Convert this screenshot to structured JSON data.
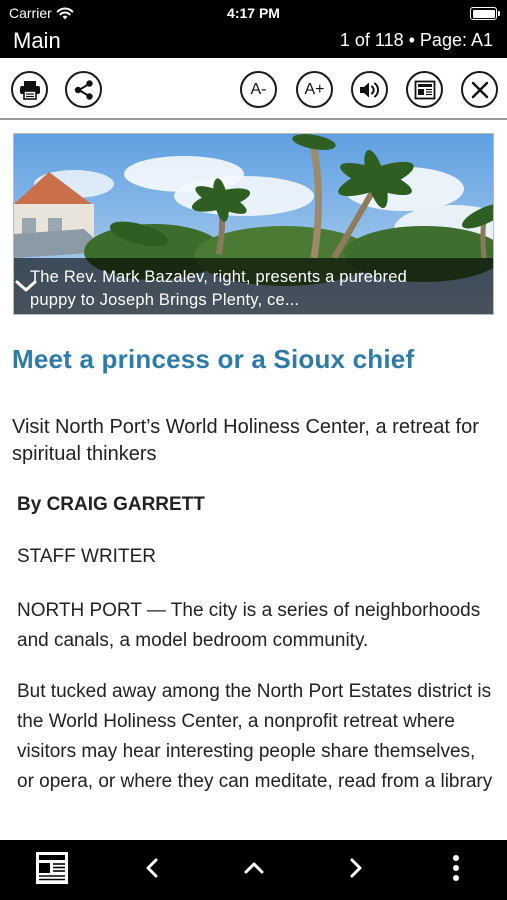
{
  "status_bar": {
    "carrier": "Carrier",
    "time": "4:17 PM",
    "battery_level": 1.0
  },
  "nav": {
    "section": "Main",
    "page_info": "1 of 118 • Page: A1"
  },
  "toolbar": {
    "decrease_font_label": "A-",
    "increase_font_label": "A+",
    "icons": [
      "printer-icon",
      "share-icon",
      "speaker-icon",
      "newspaper-icon",
      "close-icon"
    ]
  },
  "hero": {
    "caption": "The Rev. Mark Bazalev, right, presents a purebred puppy to Joseph Brings Plenty, ce..."
  },
  "article": {
    "headline": "Meet a princess or a Sioux chief",
    "subhead": "Visit North Port’s World Holiness Center, a retreat for spiritual thinkers",
    "byline": "By CRAIG GARRETT",
    "role": "STAFF WRITER",
    "paragraphs": [
      "NORTH PORT — The city is a series of neighborhoods and canals, a model bedroom community.",
      "But tucked away among the North Port Estates district is the World Holiness Center, a nonprofit retreat where visitors may hear interesting people share themselves, or opera, or where they can meditate, read from a library"
    ]
  },
  "bottom_bar": {
    "icons": [
      "page-view-icon",
      "previous-icon",
      "up-icon",
      "next-icon",
      "more-icon"
    ]
  },
  "colors": {
    "headline": "#2e7aa8",
    "bars": "#000000",
    "text": "#222222"
  }
}
